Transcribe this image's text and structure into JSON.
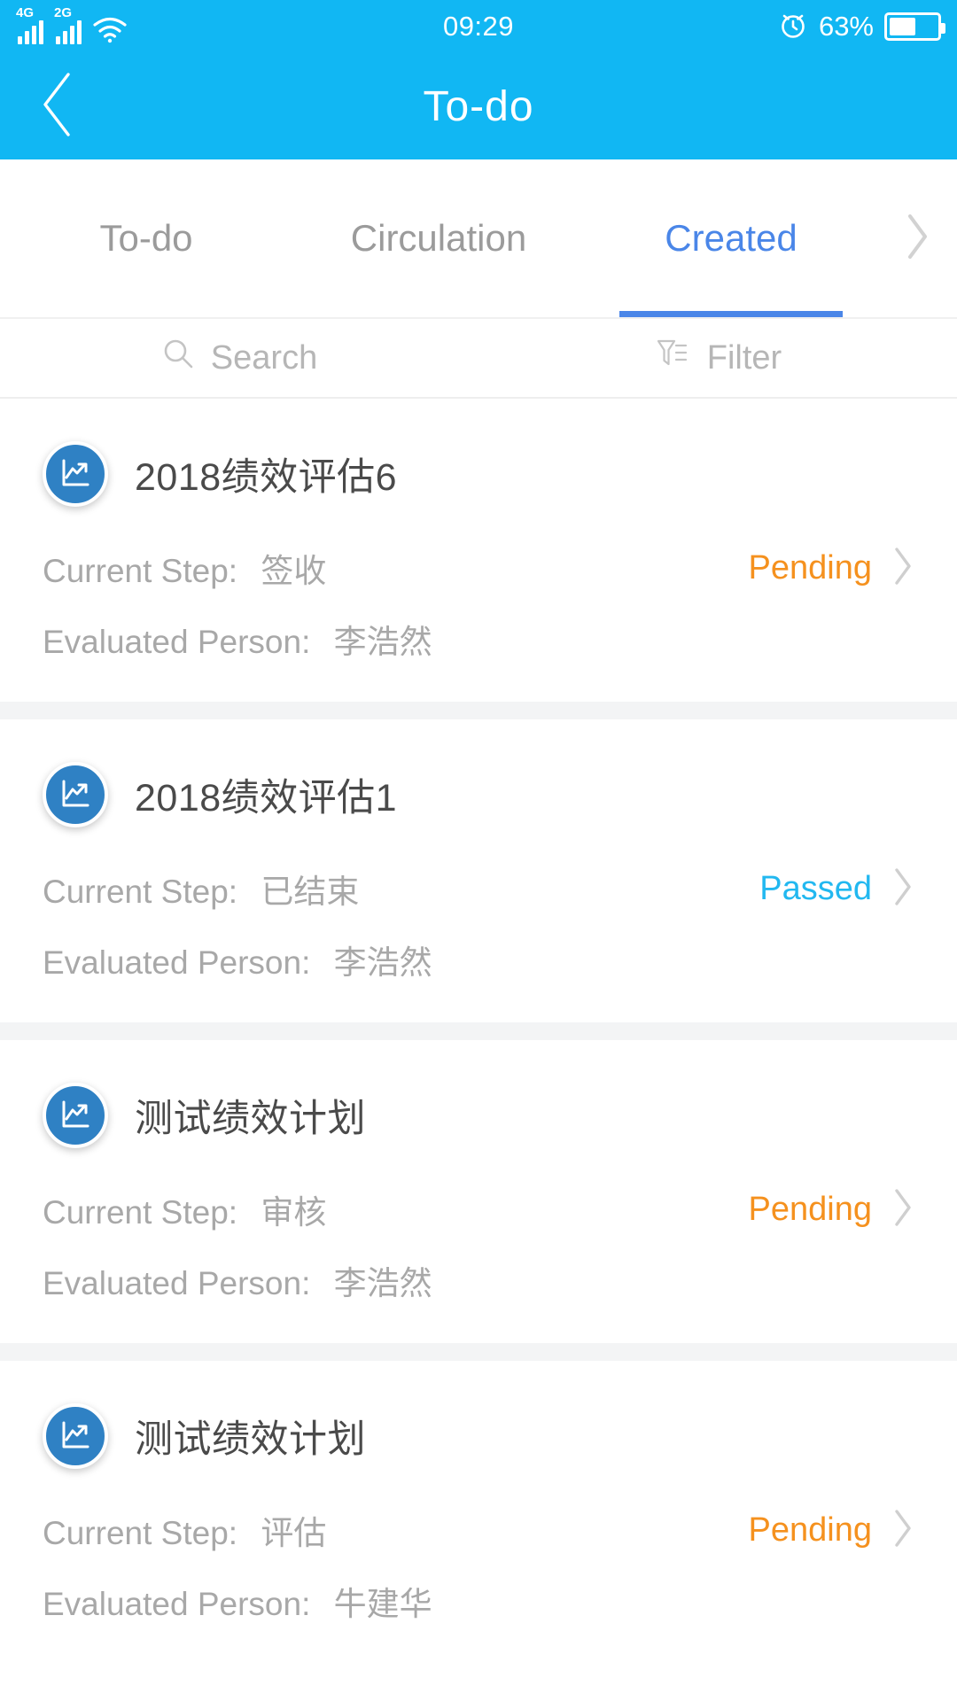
{
  "statusbar": {
    "signal_1_label": "4G",
    "signal_2_label": "2G",
    "wifi_icon": "wifi-icon",
    "time": "09:29",
    "alarm_icon": "alarm-clock-icon",
    "battery_percent": "63%",
    "battery_icon": "battery-icon"
  },
  "header": {
    "back_icon": "back-chevron-icon",
    "title": "To-do"
  },
  "tabs": {
    "items": [
      {
        "label": "To-do",
        "active": false
      },
      {
        "label": "Circulation",
        "active": false
      },
      {
        "label": "Created",
        "active": true
      }
    ],
    "more_icon": "chevron-right-icon"
  },
  "toolbar": {
    "search_icon": "search-icon",
    "search_label": "Search",
    "filter_icon": "filter-icon",
    "filter_label": "Filter"
  },
  "labels": {
    "current_step": "Current Step:",
    "evaluated_person": "Evaluated Person:"
  },
  "colors": {
    "brand_blue": "#11b7f3",
    "tab_active_blue": "#4a86e8",
    "status_pending": "#f5911e",
    "status_passed": "#22b8f0",
    "avatar_blue": "#2f81c4",
    "muted_text": "#a8a8a8"
  },
  "list": {
    "items": [
      {
        "icon": "chart-trend-icon",
        "title": "2018绩效评估6",
        "current_step_label": "Current Step:",
        "current_step_value": "签收",
        "evaluated_person_label": "Evaluated Person:",
        "evaluated_person_value": "李浩然",
        "status": "Pending",
        "status_kind": "pending",
        "chevron_icon": "chevron-right-icon"
      },
      {
        "icon": "chart-trend-icon",
        "title": "2018绩效评估1",
        "current_step_label": "Current Step:",
        "current_step_value": "已结束",
        "evaluated_person_label": "Evaluated Person:",
        "evaluated_person_value": "李浩然",
        "status": "Passed",
        "status_kind": "passed",
        "chevron_icon": "chevron-right-icon"
      },
      {
        "icon": "chart-trend-icon",
        "title": "测试绩效计划",
        "current_step_label": "Current Step:",
        "current_step_value": "审核",
        "evaluated_person_label": "Evaluated Person:",
        "evaluated_person_value": "李浩然",
        "status": "Pending",
        "status_kind": "pending",
        "chevron_icon": "chevron-right-icon"
      },
      {
        "icon": "chart-trend-icon",
        "title": "测试绩效计划",
        "current_step_label": "Current Step:",
        "current_step_value": "评估",
        "evaluated_person_label": "Evaluated Person:",
        "evaluated_person_value": "牛建华",
        "status": "Pending",
        "status_kind": "pending",
        "chevron_icon": "chevron-right-icon"
      }
    ]
  }
}
